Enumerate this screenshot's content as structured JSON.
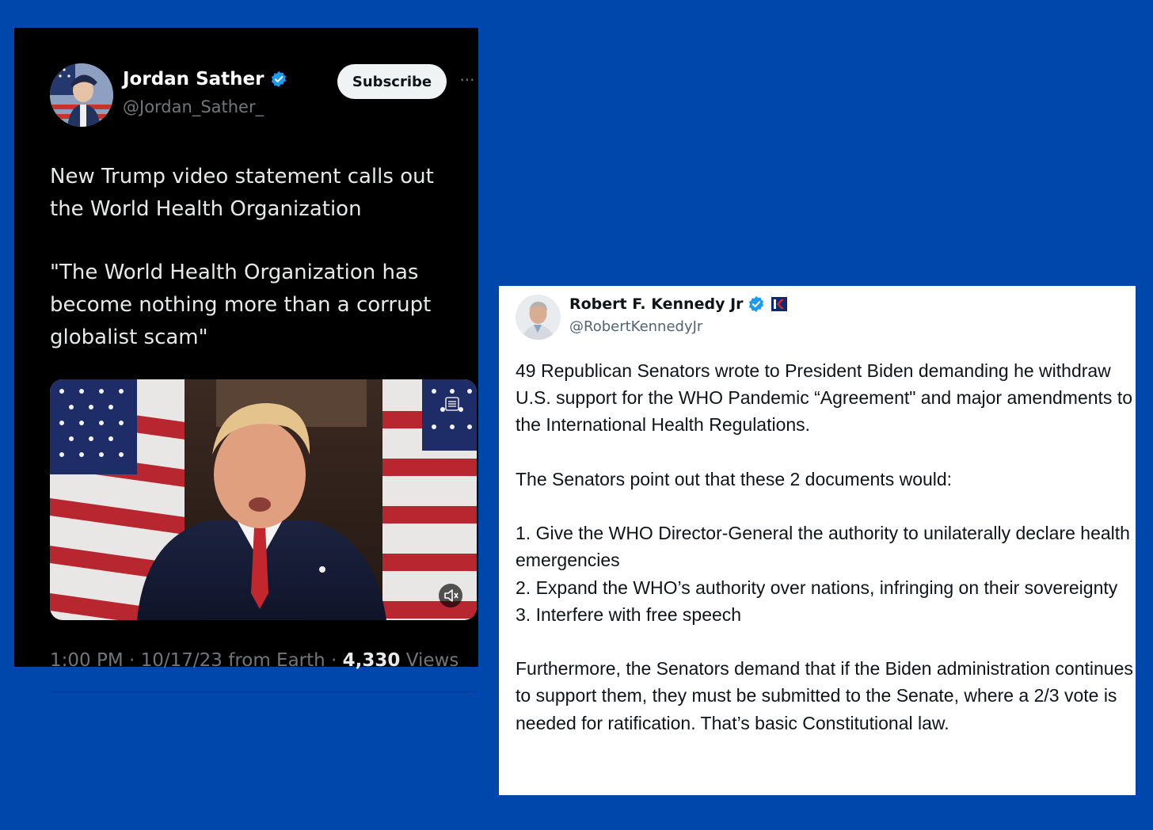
{
  "left_tweet": {
    "author": {
      "name": "Jordan Sather",
      "handle": "@Jordan_Sather_",
      "verified": true,
      "avatar": "patriot-soldier-avatar"
    },
    "subscribe_label": "Subscribe",
    "more_label": "···",
    "text": [
      "New Trump video statement calls out the World Health Organization",
      "\"The World Health Organization has become nothing more than a corrupt globalist scam\""
    ],
    "video": {
      "description_icon": "video-thumbnail",
      "mute_icon": "volume-muted-icon"
    },
    "footer": {
      "meta": "1:00 PM · 10/17/23 from Earth · ",
      "views_count": "4,330",
      "views_label": " Views"
    }
  },
  "right_tweet": {
    "author": {
      "name": "Robert F. Kennedy Jr",
      "handle": "@RobertKennedyJr",
      "verified": true,
      "affiliate_badge": "campaign-flag-icon"
    },
    "paragraphs": [
      "49 Republican Senators wrote to President Biden demanding he withdraw U.S. support for the WHO Pandemic “Agreement\" and major amendments to the International Health Regulations.",
      "",
      "The Senators point out that these 2 documents would:",
      "",
      "1.  Give the WHO Director-General the authority to unilaterally declare health emergencies",
      "2.  Expand the WHO’s authority over nations, infringing on their sovereignty",
      "3.  Interfere with free speech",
      "",
      "Furthermore, the Senators demand that if the Biden administration continues to support them, they must be submitted to the Senate, where a 2/3 vote is needed for ratification. That’s basic Constitutional law."
    ]
  },
  "colors": {
    "background": "#0047ab",
    "verified_blue": "#1d9bf0",
    "dark_card": "#000000"
  }
}
